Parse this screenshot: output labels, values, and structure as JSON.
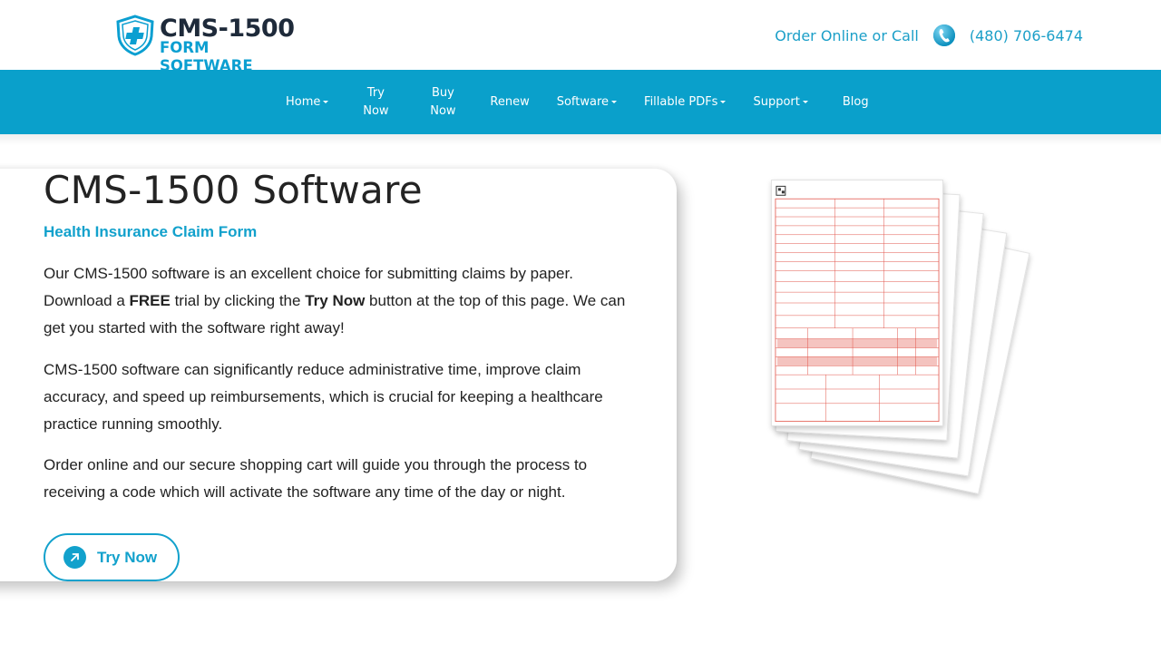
{
  "header": {
    "logo": {
      "line1": "CMS-1500",
      "line2": "FORM SOFTWARE"
    },
    "contact": {
      "text": "Order Online or Call",
      "phone": "(480) 706-6474"
    }
  },
  "nav": {
    "items": [
      {
        "label": "Home",
        "dropdown": true
      },
      {
        "label": "Try Now",
        "dropdown": false
      },
      {
        "label": "Buy Now",
        "dropdown": false
      },
      {
        "label": "Renew",
        "dropdown": false
      },
      {
        "label": "Software",
        "dropdown": true
      },
      {
        "label": "Fillable PDFs",
        "dropdown": true
      },
      {
        "label": "Support",
        "dropdown": true
      },
      {
        "label": "Blog",
        "dropdown": false
      }
    ]
  },
  "main": {
    "title": "CMS-1500 Software",
    "subtitle": "Health Insurance Claim Form",
    "p1": {
      "a": "Our CMS-1500 software is an excellent choice for submitting claims by paper. Download a ",
      "b": "FREE",
      "c": " trial by clicking the ",
      "d": "Try Now",
      "e": " button at the top of this page. We can get you started with the software right away!"
    },
    "p2": "CMS-1500 software can significantly reduce administrative time, improve claim accuracy, and speed up reimbursements, which is crucial for keeping a healthcare practice running smoothly.",
    "p3": "Order online and our secure shopping cart will guide you through the process to receiving a code which will activate the software any time of the day or night.",
    "cta": "Try Now"
  },
  "colors": {
    "brand": "#0aa0cb",
    "accent": "#12a1cc",
    "logo_dark": "#1e2a3a",
    "form_red": "#e2554a"
  },
  "icons": {
    "logo": "shield-cross-icon",
    "phone": "phone-icon",
    "cta": "arrow-up-right-icon",
    "dropdown": "caret-down-icon"
  }
}
